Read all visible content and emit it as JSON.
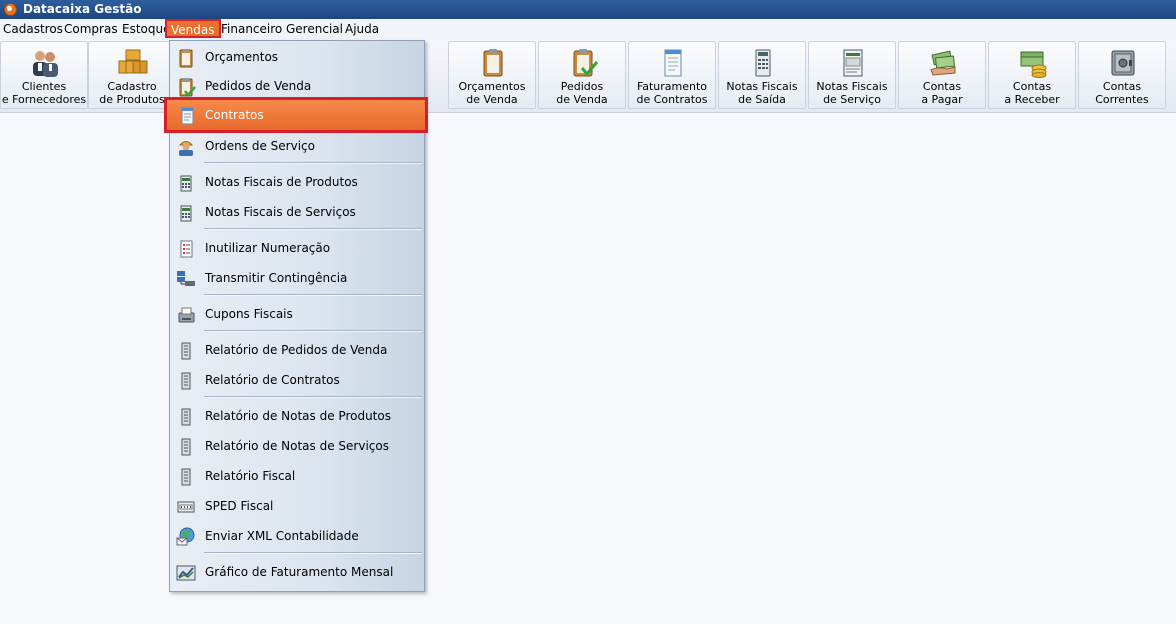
{
  "app": {
    "title": "Datacaixa Gestão"
  },
  "menubar": {
    "items": [
      {
        "label": "Cadastros"
      },
      {
        "label": "Compras"
      },
      {
        "label": "Estoque"
      },
      {
        "label": "Vendas"
      },
      {
        "label": "Financeiro"
      },
      {
        "label": "Gerencial"
      },
      {
        "label": "Ajuda"
      }
    ]
  },
  "toolbar": {
    "buttons": [
      {
        "label": "Clientes\ne Fornecedores",
        "icon": "people-icon"
      },
      {
        "label": "Cadastro\nde Produtos",
        "icon": "boxes-icon"
      },
      {
        "label": "Orçamentos\nde Venda",
        "icon": "clipboard-icon"
      },
      {
        "label": "Pedidos\nde Venda",
        "icon": "clipboard-check-icon"
      },
      {
        "label": "Faturamento\nde Contratos",
        "icon": "document-icon"
      },
      {
        "label": "Notas Fiscais\nde Saída",
        "icon": "calculator-icon"
      },
      {
        "label": "Notas Fiscais\nde Serviço",
        "icon": "invoice-icon"
      },
      {
        "label": "Contas\na Pagar",
        "icon": "money-hand-icon"
      },
      {
        "label": "Contas\na Receber",
        "icon": "money-coins-icon"
      },
      {
        "label": "Contas\nCorrentes",
        "icon": "safe-icon"
      }
    ]
  },
  "dropdown": {
    "items": [
      {
        "label": "Orçamentos",
        "icon": "clipboard-icon"
      },
      {
        "label": "Pedidos de Venda",
        "icon": "clipboard-check-icon"
      },
      {
        "label": "Contratos",
        "icon": "contract-icon"
      },
      {
        "label": "Ordens de Serviço",
        "icon": "worker-icon"
      },
      {
        "label": "Notas Fiscais de Produtos",
        "icon": "calculator-icon"
      },
      {
        "label": "Notas Fiscais de Serviços",
        "icon": "calculator-icon"
      },
      {
        "label": "Inutilizar Numeração",
        "icon": "list-icon"
      },
      {
        "label": "Transmitir Contingência",
        "icon": "network-icon"
      },
      {
        "label": "Cupons Fiscais",
        "icon": "printer-icon"
      },
      {
        "label": "Relatório de Pedidos de Venda",
        "icon": "report-icon"
      },
      {
        "label": "Relatório de Contratos",
        "icon": "report-icon"
      },
      {
        "label": "Relatório de Notas de Produtos",
        "icon": "report-icon"
      },
      {
        "label": "Relatório de Notas de Serviços",
        "icon": "report-icon"
      },
      {
        "label": "Relatório Fiscal",
        "icon": "report-icon"
      },
      {
        "label": "SPED Fiscal",
        "icon": "sped-icon"
      },
      {
        "label": "Enviar XML Contabilidade",
        "icon": "globe-mail-icon"
      },
      {
        "label": "Gráfico de Faturamento Mensal",
        "icon": "chart-icon"
      }
    ],
    "highlighted": "Contratos"
  },
  "colors": {
    "titlebar": "#1d4680",
    "highlight": "#e86a2b",
    "highlight_border": "#d71f2b"
  }
}
